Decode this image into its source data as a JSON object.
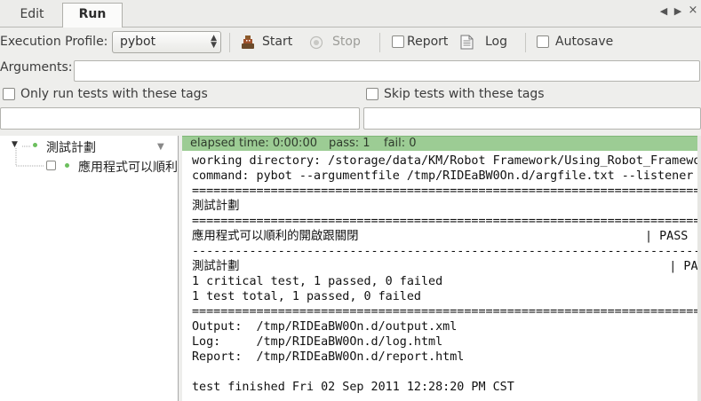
{
  "tabs": {
    "edit": "Edit",
    "run": "Run"
  },
  "toolbar": {
    "execution_profile_label": "Execution Profile:",
    "profile_value": "pybot",
    "start_label": "Start",
    "stop_label": "Stop",
    "report_label": "Report",
    "log_label": "Log",
    "autosave_label": "Autosave"
  },
  "arguments": {
    "label": "Arguments:",
    "value": ""
  },
  "tags": {
    "only_run_label": "Only run tests with these tags",
    "skip_label": "Skip tests with these tags",
    "only_run_value": "",
    "skip_value": ""
  },
  "tree": {
    "suite": "測試計劃",
    "test": "應用程式可以順利的開啟跟關閉"
  },
  "status": {
    "elapsed": "elapsed time: 0:00:00",
    "pass": "pass: 1",
    "fail": "fail: 0",
    "color": "#9ccc94"
  },
  "output": {
    "lines": [
      "working directory: /storage/data/KM/Robot Framework/Using_Robot_Framework",
      "command: pybot --argumentfile /tmp/RIDEaBW0On.d/argfile.txt --listener",
      "==============================================================================",
      "測試計劃",
      "==============================================================================",
      "應用程式可以順利的開啟跟關閉                                        | PASS |",
      "------------------------------------------------------------------------------",
      "測試計劃                                                            | PASS |",
      "1 critical test, 1 passed, 0 failed",
      "1 test total, 1 passed, 0 failed",
      "==============================================================================",
      "Output:  /tmp/RIDEaBW0On.d/output.xml",
      "Log:     /tmp/RIDEaBW0On.d/log.html",
      "Report:  /tmp/RIDEaBW0On.d/report.html",
      "",
      "test finished Fri 02 Sep 2011 12:28:20 PM CST"
    ]
  }
}
